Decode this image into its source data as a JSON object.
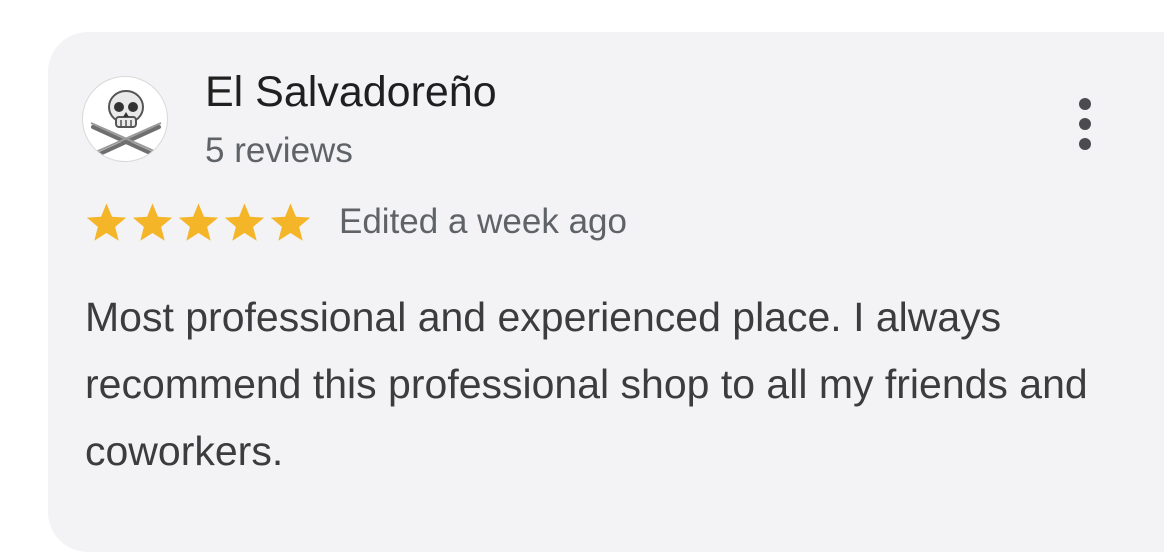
{
  "review": {
    "author_name": "El Salvadoreño",
    "author_reviews": "5 reviews",
    "avatar_icon": "skull-crossed-rifles-avatar",
    "rating": 5,
    "rating_max": 5,
    "star_color": "#f4b528",
    "timestamp": "Edited a week ago",
    "text": "Most professional and experienced place. I always recommend this professional shop to all my friends and coworkers.",
    "more_options_icon": "more-vert-icon"
  }
}
